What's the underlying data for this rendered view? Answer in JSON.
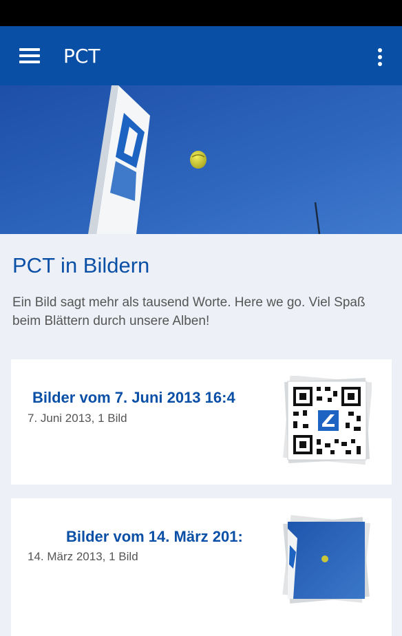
{
  "app_bar": {
    "title": "PCT",
    "menu_icon": "hamburger-menu-icon",
    "overflow_icon": "more-vert-icon",
    "color": "#0a4fa6"
  },
  "intro": {
    "title": "PCT in Bildern",
    "text": "Ein Bild sagt mehr als tausend Worte. Here we go. Viel Spaß beim Blättern durch unsere Alben!"
  },
  "albums": [
    {
      "title": "Bilder vom 7. Juni 2013 16:4",
      "meta": "7. Juni 2013, 1 Bild",
      "thumbnail": "qr-code-thumbnail"
    },
    {
      "title": "Bilder vom 14. März 201:",
      "meta": "14. März 2013, 1 Bild",
      "thumbnail": "sky-photo-thumbnail"
    }
  ]
}
